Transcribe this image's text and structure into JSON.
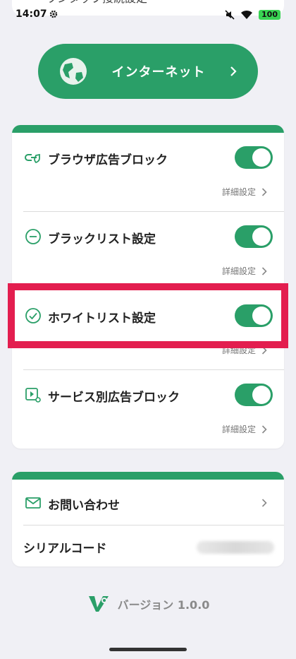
{
  "status_bar": {
    "time": "14:07",
    "battery": "100"
  },
  "top_card": {
    "partial_label": "ワンタップ接続設定"
  },
  "internet_button": {
    "label": "インターネット"
  },
  "settings_card": {
    "items": [
      {
        "label": "ブラウザ広告ブロック",
        "icon": "link-shield-icon",
        "enabled": true,
        "detail_label": "詳細設定"
      },
      {
        "label": "ブラックリスト設定",
        "icon": "minus-circle-icon",
        "enabled": true,
        "detail_label": "詳細設定"
      },
      {
        "label": "ホワイトリスト設定",
        "icon": "check-circle-icon",
        "enabled": true,
        "detail_label": "詳細設定"
      },
      {
        "label": "サービス別広告ブロック",
        "icon": "video-gear-icon",
        "enabled": true,
        "detail_label": "詳細設定"
      }
    ]
  },
  "info_card": {
    "contact_label": "お問い合わせ",
    "serial_label": "シリアルコード"
  },
  "version": {
    "label": "バージョン 1.0.0"
  },
  "colors": {
    "accent": "#2a9f68",
    "highlight": "#e31e4f",
    "background": "#f0f0f5"
  }
}
